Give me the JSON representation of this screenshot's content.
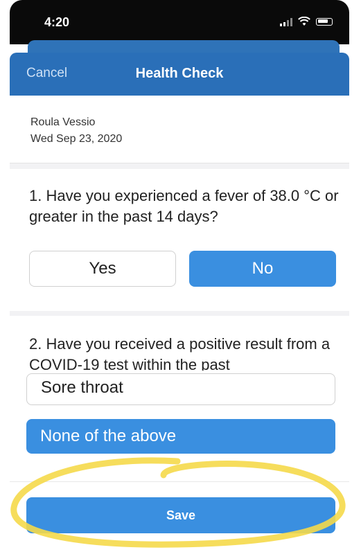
{
  "status_bar": {
    "time": "4:20"
  },
  "header": {
    "cancel_label": "Cancel",
    "title": "Health Check"
  },
  "profile": {
    "name": "Roula Vessio",
    "date": "Wed Sep 23, 2020"
  },
  "question1": {
    "text": "1. Have you experienced a fever of 38.0 °C or greater in the past 14 days?",
    "yes_label": "Yes",
    "no_label": "No",
    "selected": "No"
  },
  "question2": {
    "text": "2. Have you received a positive result from a COVID-19 test within the past"
  },
  "options": {
    "sore_throat": "Sore throat",
    "none_of_above": "None of the above"
  },
  "footer": {
    "save_label": "Save"
  },
  "colors": {
    "header": "#2a6fb8",
    "accent": "#3a8fe0",
    "highlight": "#f5d94a"
  }
}
